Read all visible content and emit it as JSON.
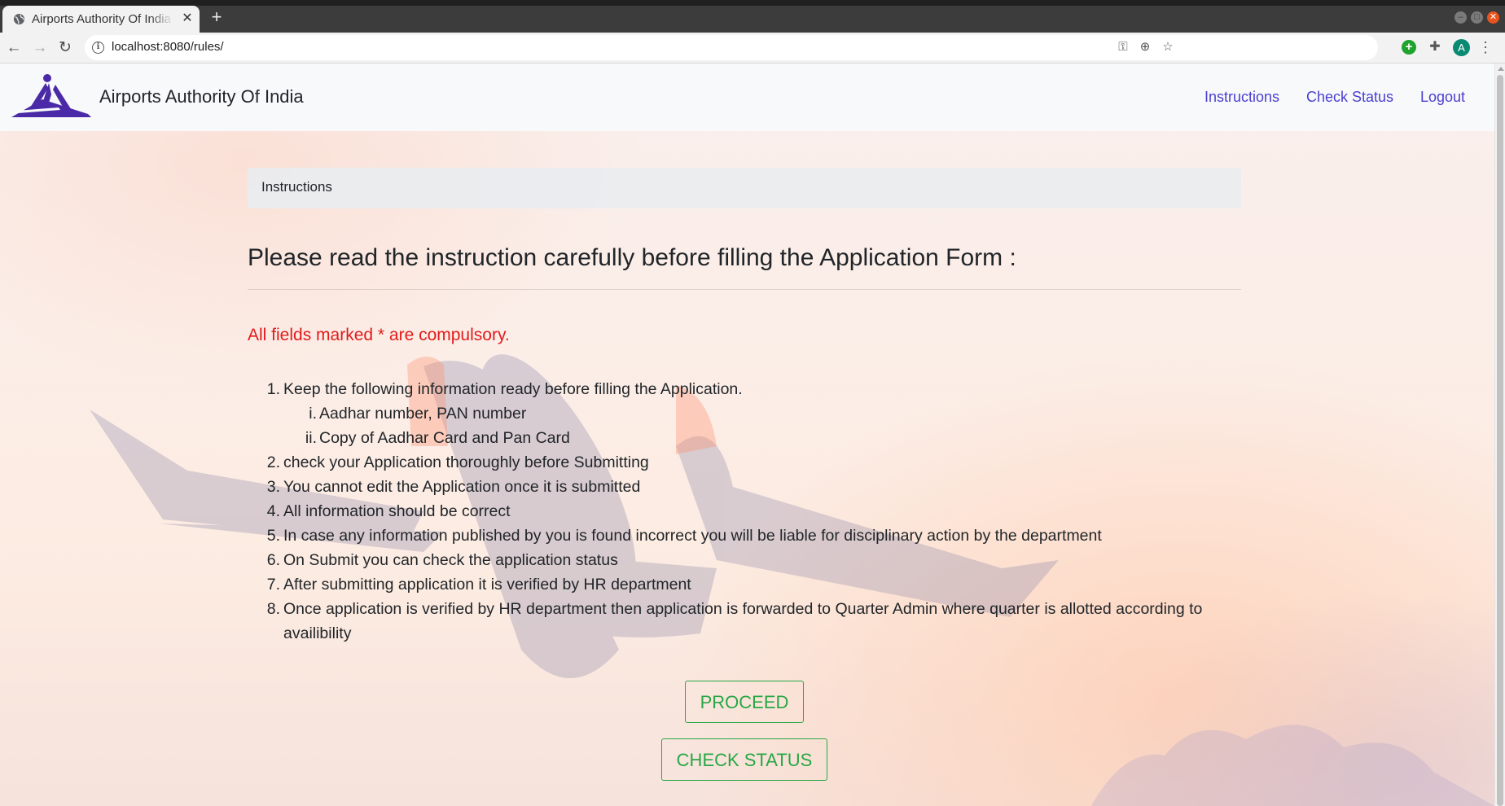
{
  "browser": {
    "tab_title": "Airports Authority Of India",
    "new_tab_label": "+",
    "close_tab_label": "✕",
    "url": "localhost:8080/rules/",
    "profile_initial": "A"
  },
  "navbar": {
    "brand": "Airports Authority Of India",
    "links": [
      "Instructions",
      "Check Status",
      "Logout"
    ]
  },
  "breadcrumb": "Instructions",
  "heading": "Please read the instruction carefully before filling the Application Form :",
  "required_note": "All fields marked * are compulsory.",
  "instructions": [
    {
      "num": "1.",
      "text": "Keep the following information ready before filling the Application."
    },
    {
      "num": "i.",
      "text": "Aadhar number, PAN number"
    },
    {
      "num": "ii.",
      "text": "Copy of Aadhar Card and Pan Card"
    },
    {
      "num": "2.",
      "text": "check your Application thoroughly before Submitting"
    },
    {
      "num": "3.",
      "text": "You cannot edit the Application once it is submitted"
    },
    {
      "num": "4.",
      "text": "All information should be correct"
    },
    {
      "num": "5.",
      "text": "In case any information published by you is found incorrect you will be liable for disciplinary action by the department"
    },
    {
      "num": "6.",
      "text": "On Submit you can check the application status"
    },
    {
      "num": "7.",
      "text": "After submitting application it is verified by HR department"
    },
    {
      "num": "8.",
      "text": "Once application is verified by HR department then application is forwarded to Quarter Admin where quarter is allotted according to availibility"
    }
  ],
  "buttons": {
    "proceed": "PROCEED",
    "check_status": "CHECK STATUS"
  },
  "colors": {
    "brand_purple": "#4a3fd0",
    "required_red": "#e21b1b",
    "button_green": "#28a745"
  }
}
